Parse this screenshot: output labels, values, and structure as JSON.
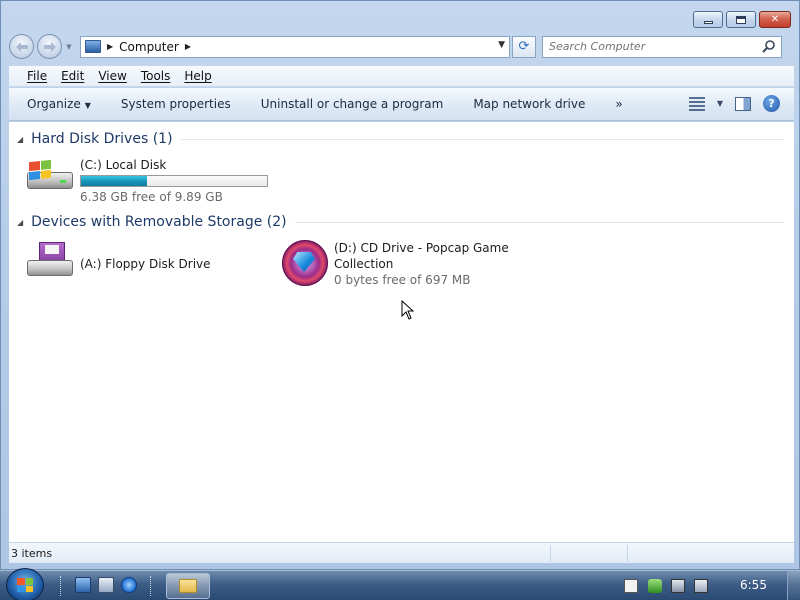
{
  "window": {
    "minimize_icon": "minimize-icon",
    "maximize_icon": "maximize-icon",
    "close_icon": "close-icon",
    "close_glyph": "✕"
  },
  "nav": {
    "back_icon": "back-arrow-icon",
    "forward_icon": "forward-arrow-icon",
    "address_path": "Computer",
    "search_placeholder": "Search Computer",
    "refresh_glyph": "⟳"
  },
  "menubar": {
    "items": [
      "File",
      "Edit",
      "View",
      "Tools",
      "Help"
    ]
  },
  "commandbar": {
    "organize": "Organize",
    "system_properties": "System properties",
    "uninstall": "Uninstall or change a program",
    "map_drive": "Map network drive",
    "more": "»",
    "help_glyph": "?"
  },
  "groups": [
    {
      "title": "Hard Disk Drives (1)",
      "items": [
        {
          "name": "(C:) Local Disk",
          "detail": "6.38 GB free of 9.89 GB",
          "used_fraction": 0.355,
          "icon": "hard-disk-icon"
        }
      ]
    },
    {
      "title": "Devices with Removable Storage (2)",
      "items": [
        {
          "name": "(A:) Floppy Disk Drive",
          "detail": "",
          "icon": "floppy-drive-icon"
        },
        {
          "name_line1": "(D:) CD Drive - Popcap Game",
          "name_line2": "Collection",
          "detail": "0 bytes free of 697 MB",
          "icon": "cd-drive-icon"
        }
      ]
    }
  ],
  "status": {
    "items_count": "3 items"
  },
  "taskbar": {
    "clock": "6:55",
    "accent": "#2a4a73"
  },
  "colors": {
    "capacity_bar": "#1793b8",
    "group_title": "#1e3a68"
  }
}
